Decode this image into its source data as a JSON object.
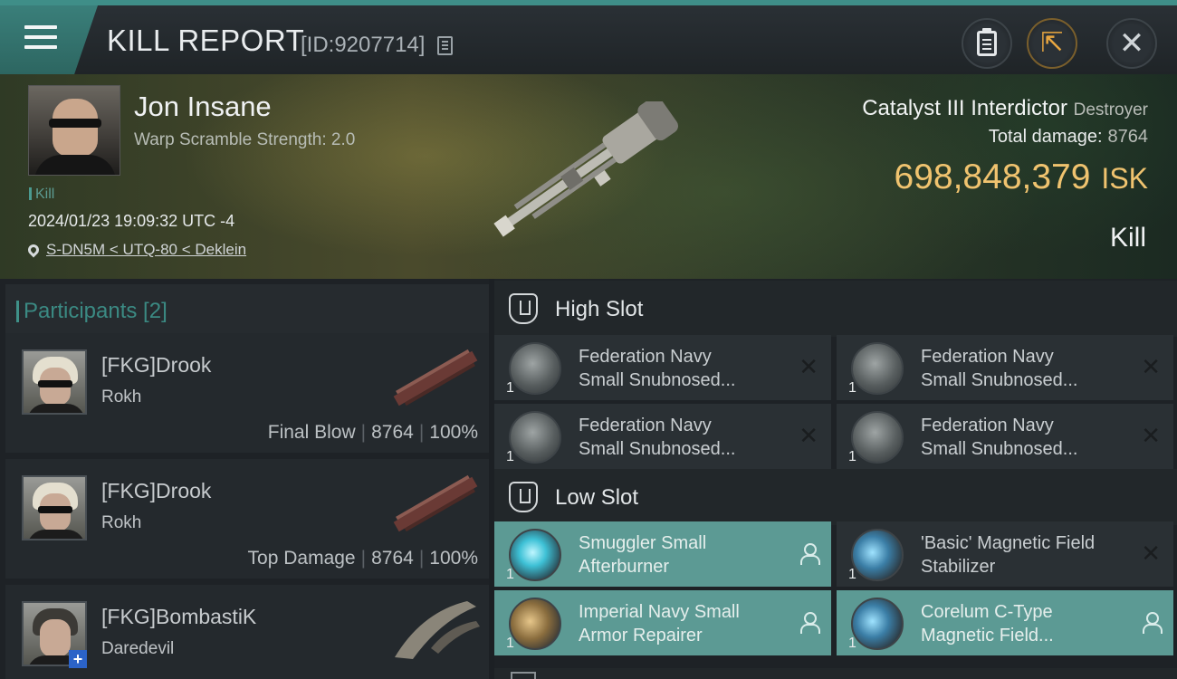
{
  "header": {
    "title": "KILL REPORT",
    "report_id": "[ID:9207714]",
    "icons": [
      "menu-icon",
      "copy-icon",
      "clipboard-icon",
      "share-icon",
      "close-icon"
    ]
  },
  "victim": {
    "name": "Jon Insane",
    "warp_scramble": "Warp Scramble Strength: 2.0",
    "tag": "Kill",
    "datetime": "2024/01/23 19:09:32 UTC -4",
    "location": "S-DN5M < UTQ-80 < Deklein",
    "ship_name": "Catalyst III Interdictor",
    "ship_class": "Destroyer",
    "total_damage_label": "Total damage:",
    "total_damage_value": "8764",
    "isk_value": "698,848,379",
    "isk_unit": "ISK",
    "result": "Kill"
  },
  "participants": {
    "header": "Participants [2]",
    "items": [
      {
        "name": "[FKG]Drook",
        "ship": "Rokh",
        "role": "Final Blow",
        "damage": "8764",
        "percent": "100%"
      },
      {
        "name": "[FKG]Drook",
        "ship": "Rokh",
        "role": "Top Damage",
        "damage": "8764",
        "percent": "100%"
      },
      {
        "name": "[FKG]BombastiK",
        "ship": "Daredevil"
      }
    ]
  },
  "slots": {
    "high": {
      "label": "High Slot",
      "modules": [
        {
          "qty": "1",
          "line1": "Federation Navy",
          "line2": "Small Snubnosed..."
        },
        {
          "qty": "1",
          "line1": "Federation Navy",
          "line2": "Small Snubnosed..."
        },
        {
          "qty": "1",
          "line1": "Federation Navy",
          "line2": "Small Snubnosed..."
        },
        {
          "qty": "1",
          "line1": "Federation Navy",
          "line2": "Small Snubnosed..."
        }
      ]
    },
    "low": {
      "label": "Low Slot",
      "modules": [
        {
          "qty": "1",
          "line1": "Smuggler Small",
          "line2": "Afterburner",
          "status": "dropped"
        },
        {
          "qty": "1",
          "line1": "'Basic' Magnetic Field",
          "line2": "Stabilizer",
          "status": "destroyed"
        },
        {
          "qty": "1",
          "line1": "Imperial Navy Small",
          "line2": "Armor Repairer",
          "status": "dropped"
        },
        {
          "qty": "1",
          "line1": "Corelum C-Type",
          "line2": "Magnetic Field...",
          "status": "dropped"
        }
      ]
    }
  },
  "colors": {
    "accent_teal": "#3f8e88",
    "isk_gold": "#f0c36f",
    "fitted_bg": "#5c9a94"
  }
}
